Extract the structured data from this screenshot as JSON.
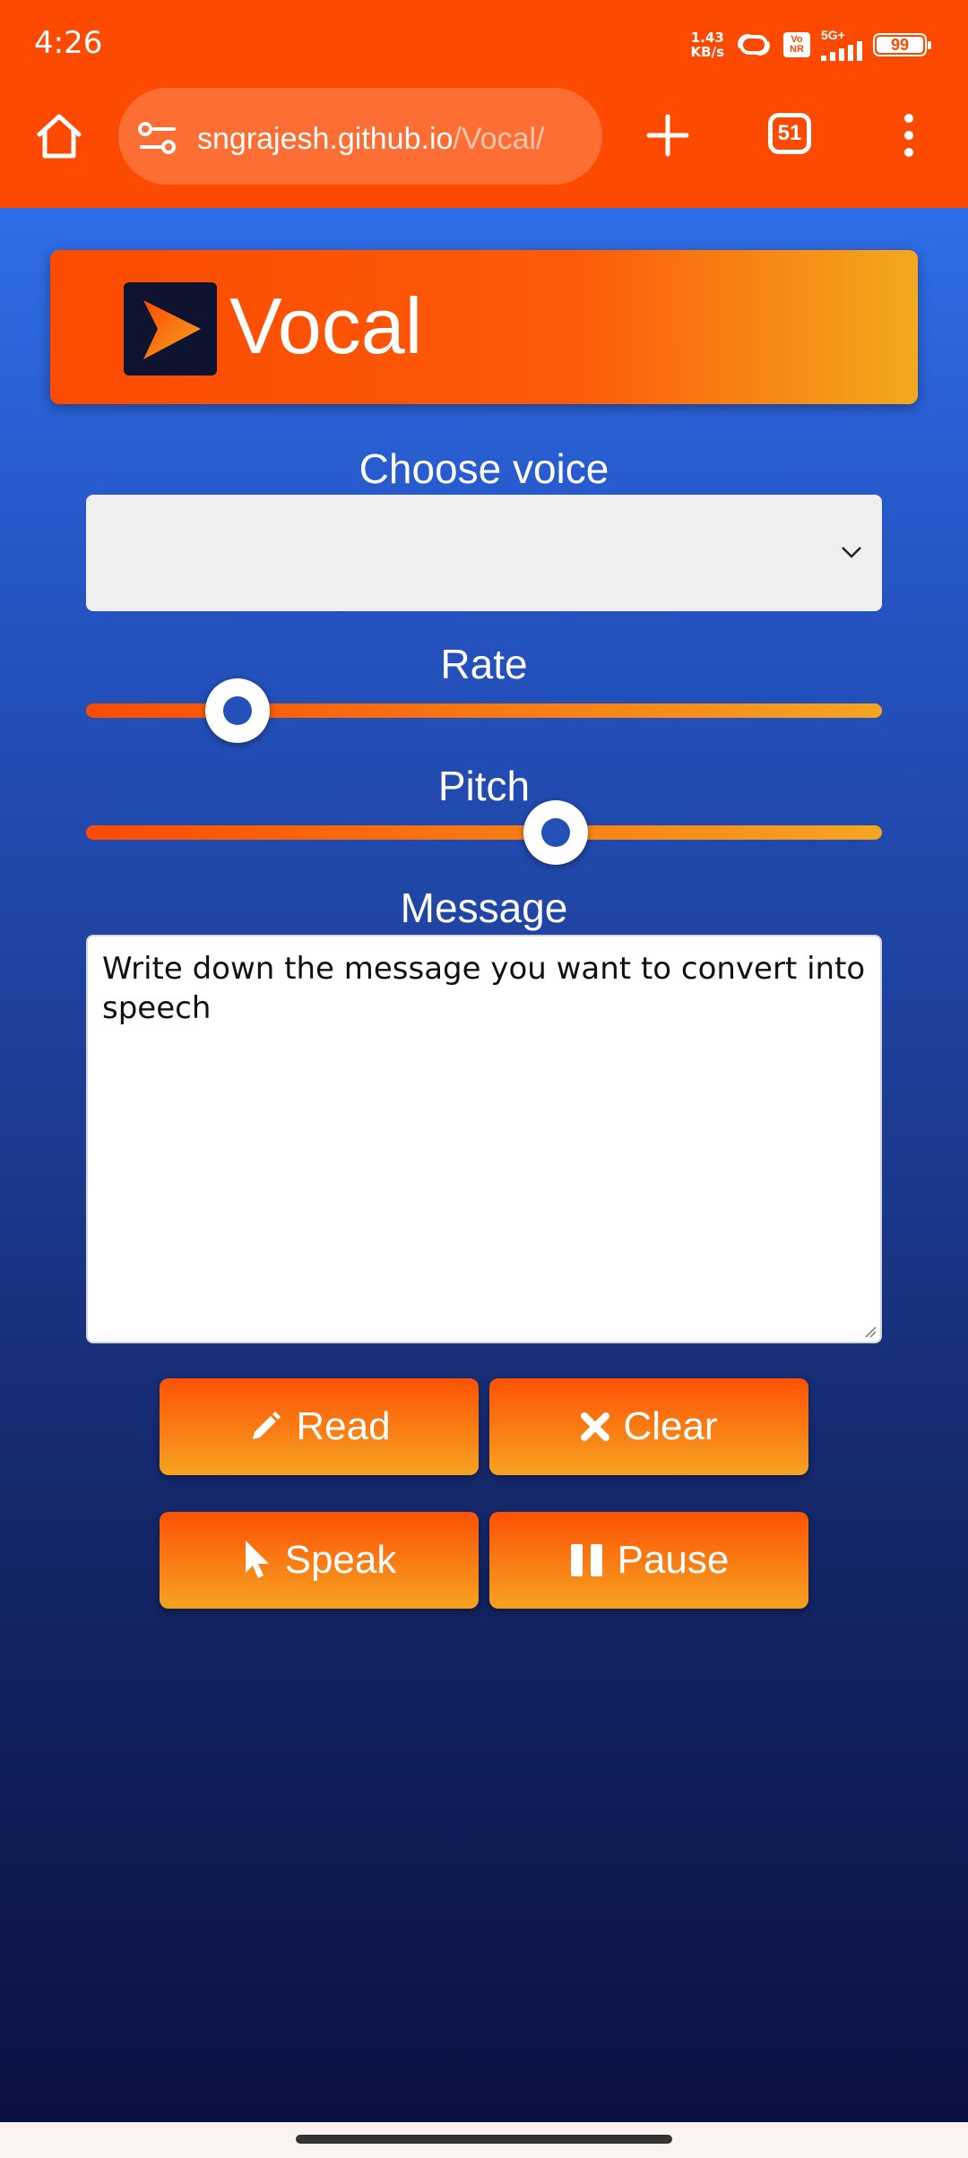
{
  "status_bar": {
    "time": "4:26",
    "net_speed_value": "1.43",
    "net_speed_unit": "KB/s",
    "vonr_line1": "Vo",
    "vonr_line2": "NR",
    "signal_label": "5G+",
    "battery": "99"
  },
  "browser": {
    "url_domain": "sngrajesh.github.io",
    "url_path": "/Vocal/",
    "tab_count": "51",
    "accent_color": "#fc4a02"
  },
  "app": {
    "title": "Vocal",
    "choose_voice_label": "Choose voice",
    "voice_selected": "",
    "rate_label": "Rate",
    "rate_position_fraction": 0.19,
    "pitch_label": "Pitch",
    "pitch_position_fraction": 0.59,
    "message_label": "Message",
    "message_text": "Write down the message you want to convert into speech",
    "buttons": {
      "read": "Read",
      "clear": "Clear",
      "speak": "Speak",
      "pause": "Pause"
    },
    "icons": {
      "read": "pencil-icon",
      "clear": "times-icon",
      "speak": "pointer-icon",
      "pause": "pause-icon"
    }
  }
}
